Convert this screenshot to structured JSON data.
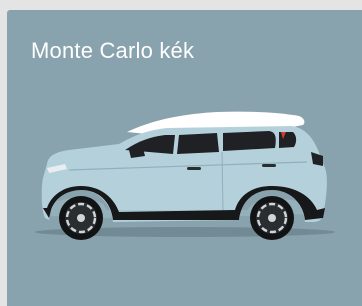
{
  "swatch": {
    "color_name": "Monte Carlo kék",
    "card_color": "#88a2ae",
    "page_background": "#e4e4e4",
    "car_body_color": "#b4d1db",
    "car_roof_color": "#ffffff",
    "car_glass_color": "#1f2124",
    "car_trim_color": "#16181a"
  }
}
